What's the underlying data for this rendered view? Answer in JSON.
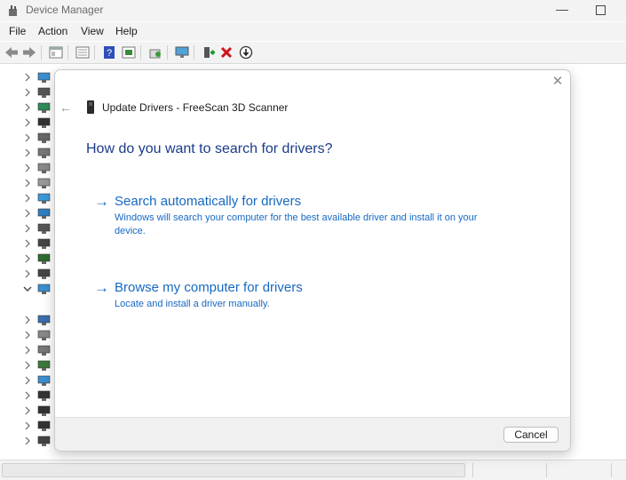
{
  "window": {
    "title": "Device Manager",
    "minimize_glyph": "—"
  },
  "menu": [
    {
      "label": "File"
    },
    {
      "label": "Action"
    },
    {
      "label": "View"
    },
    {
      "label": "Help"
    }
  ],
  "toolbar": {
    "buttons": [
      "back-icon",
      "forward-icon",
      "properties-icon",
      "update-list-icon",
      "help-icon",
      "show-hidden-icon",
      "scan-hardware-icon",
      "monitor-icon",
      "add-driver-icon",
      "uninstall-icon",
      "disable-icon"
    ]
  },
  "tree": {
    "rows": [
      {
        "icon": "computer-icon",
        "expanded": false
      },
      {
        "icon": "disk-drive-icon",
        "expanded": false
      },
      {
        "icon": "display-adapter-icon",
        "expanded": false
      },
      {
        "icon": "firmware-icon",
        "expanded": false
      },
      {
        "icon": "human-interface-icon",
        "expanded": false
      },
      {
        "icon": "ide-controller-icon",
        "expanded": false
      },
      {
        "icon": "keyboard-icon",
        "expanded": false
      },
      {
        "icon": "mouse-icon",
        "expanded": false
      },
      {
        "icon": "monitor-icon",
        "expanded": false
      },
      {
        "icon": "network-adapter-icon",
        "expanded": false
      },
      {
        "icon": "print-queue-icon",
        "expanded": false
      },
      {
        "icon": "printer-icon",
        "expanded": false
      },
      {
        "icon": "processor-icon",
        "expanded": false
      },
      {
        "icon": "security-device-icon",
        "expanded": false
      },
      {
        "icon": "network-device-icon",
        "expanded": true
      },
      {
        "icon": "software-component-icon",
        "expanded": false
      },
      {
        "icon": "storage-icon",
        "expanded": false
      },
      {
        "icon": "sound-icon",
        "expanded": false
      },
      {
        "icon": "system-device-icon",
        "expanded": false
      },
      {
        "icon": "usb-controller-icon",
        "expanded": false
      },
      {
        "icon": "usb-device-icon",
        "expanded": false
      },
      {
        "icon": "usb-connector-icon",
        "expanded": false
      },
      {
        "icon": "usb-device-icon",
        "expanded": false
      },
      {
        "icon": "printer-icon",
        "expanded": false
      }
    ]
  },
  "dialog": {
    "title": "Update Drivers - FreeScan 3D Scanner",
    "close_glyph": "✕",
    "back_glyph": "←",
    "question": "How do you want to search for drivers?",
    "options": [
      {
        "arrow": "→",
        "title": "Search automatically for drivers",
        "description": "Windows will search your computer for the best available driver and install it on your device."
      },
      {
        "arrow": "→",
        "title": "Browse my computer for drivers",
        "description": "Locate and install a driver manually."
      }
    ],
    "cancel_label": "Cancel"
  },
  "colors": {
    "link_blue": "#1669c3",
    "heading_blue": "#1a3b8a",
    "chrome_bg": "#f3f3f3"
  }
}
